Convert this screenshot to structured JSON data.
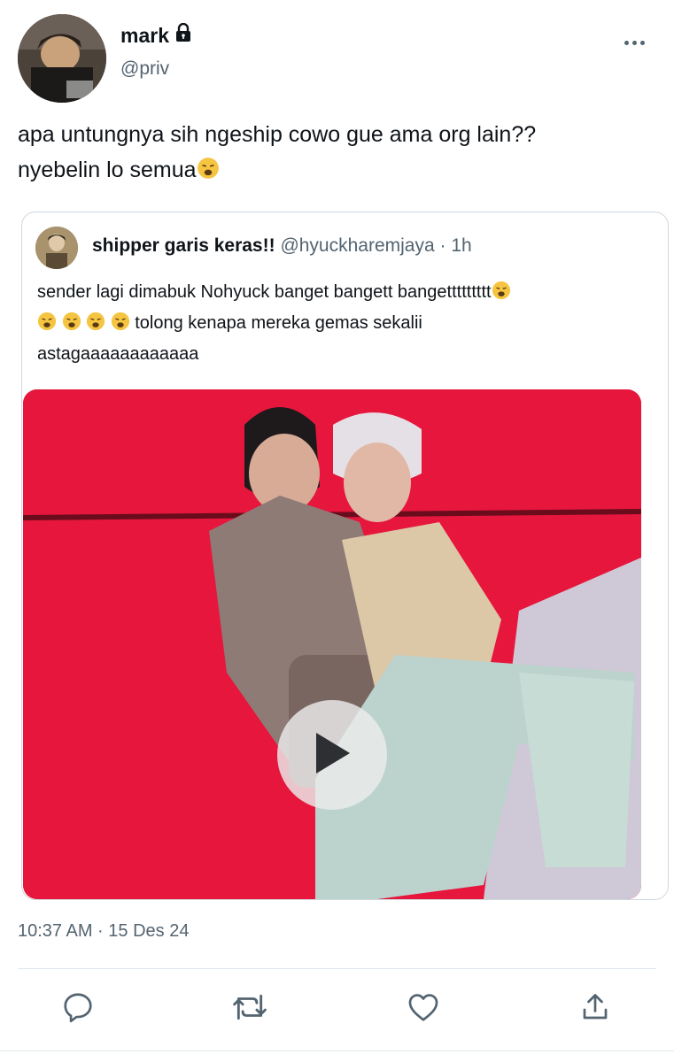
{
  "author": {
    "name": "mark",
    "handle": "@priv",
    "lock_icon": "lock-icon"
  },
  "tweet": {
    "line1": "apa untungnya sih ngeship cowo gue ama org lain??",
    "line2": "nyebelin lo semua",
    "emoji": "weary-face-emoji"
  },
  "quote": {
    "name": "shipper garis keras!!",
    "handle": "@hyuckharemjaya",
    "separator": "·",
    "time": "1h",
    "line1": "sender lagi dimabuk Nohyuck banget bangett bangettttttttt",
    "line2": "tolong kenapa mereka gemas sekalii",
    "line3": "astagaaaaaaaaaaaa",
    "emoji_row_count": 4
  },
  "media": {
    "type": "video",
    "play_icon": "play-icon"
  },
  "timestamp": "10:37 AM · 15 Des 24",
  "actions": [
    {
      "name": "reply",
      "icon": "reply-icon"
    },
    {
      "name": "retweet",
      "icon": "retweet-icon"
    },
    {
      "name": "like",
      "icon": "heart-icon"
    },
    {
      "name": "share",
      "icon": "share-icon"
    }
  ],
  "colors": {
    "text": "#0f1419",
    "secondary": "#536471",
    "border": "#cfd9de",
    "media_bg": "#e6163d"
  }
}
